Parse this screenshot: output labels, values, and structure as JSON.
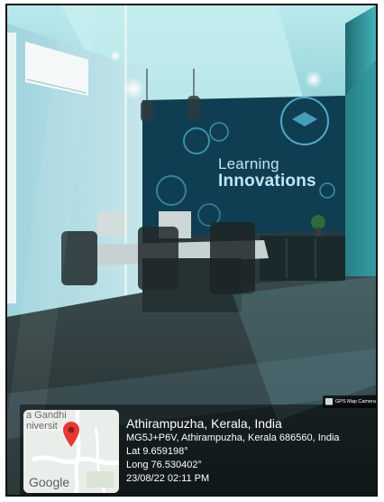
{
  "wall_sign": {
    "line1": "Learning",
    "line2": "Innovations"
  },
  "overlay": {
    "app_badge": "GPS Map Camera",
    "location_title": "Athirampuzha, Kerala, India",
    "address": "MG5J+P6V, Athirampuzha, Kerala 686560, India",
    "lat": "Lat 9.659198°",
    "long": "Long 76.530402°",
    "datetime": "23/08/22 02:11 PM"
  },
  "map": {
    "label_line1": "a Gandhi",
    "label_line2": "niversit",
    "logo": "Google",
    "pin_icon": "map-pin-icon"
  }
}
